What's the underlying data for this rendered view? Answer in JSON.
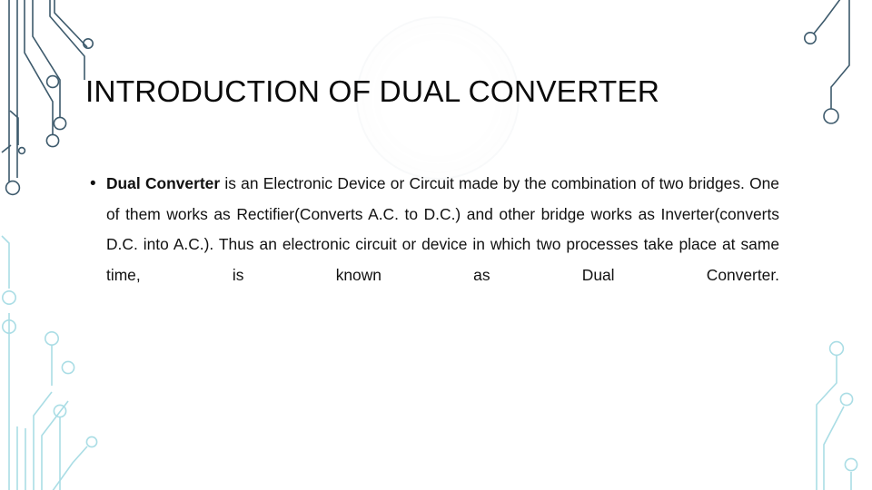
{
  "slide": {
    "title": "INTRODUCTION OF DUAL CONVERTER",
    "background_color": "#ffffff",
    "text_color": "#111111",
    "title_color": "#0a0a0a"
  },
  "body": {
    "bullet_glyph": "•",
    "lead_bold": "Dual  Converter",
    "rest": " is  an Electronic  Device or  Circuit  made  by  the combination of two bridges. One of them works as Rectifier(Converts A.C. to D.C.) and other  bridge  works  as  Inverter(converts D.C. into A.C.). Thus an electronic circuit or device in which two processes take place at same time, is known as Dual Converter."
  },
  "decor": {
    "dark_trace_color": "#3d5a6c",
    "light_trace_color": "#aadde5",
    "watermark_color": "#f2f5f6",
    "top_left_name": "circuit-traces-top-left",
    "bottom_left_name": "circuit-traces-bottom-left",
    "top_right_name": "circuit-traces-top-right",
    "bottom_right_name": "circuit-traces-bottom-right"
  }
}
